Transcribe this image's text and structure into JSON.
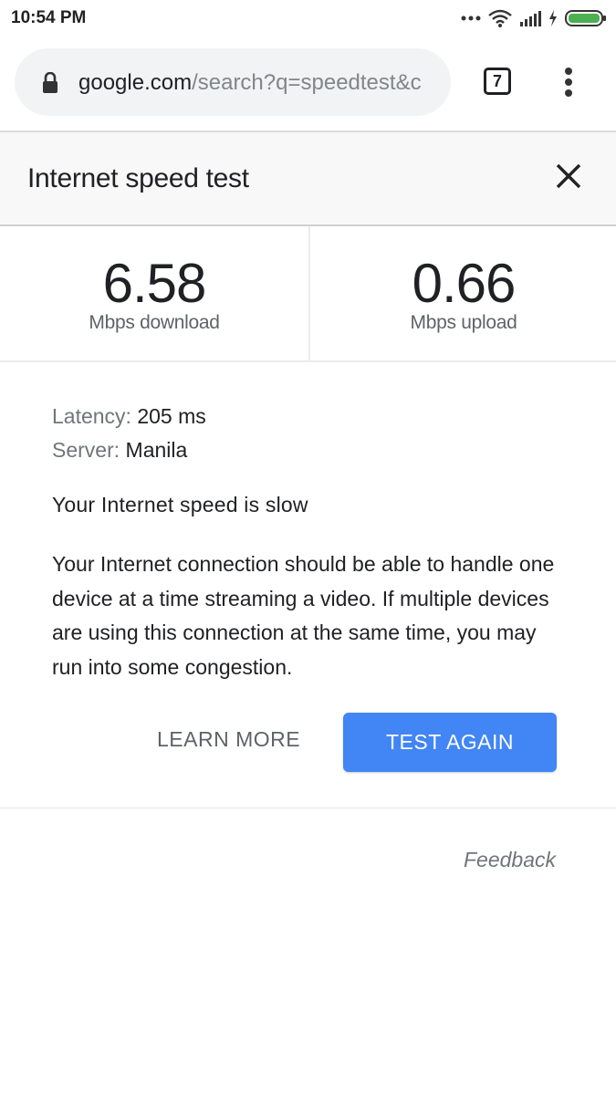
{
  "status_bar": {
    "time": "10:54 PM"
  },
  "browser": {
    "url_host": "google.com",
    "url_rest": "/search?q=speedtest&c",
    "tab_count": "7"
  },
  "speed_test": {
    "title": "Internet speed test",
    "download": {
      "value": "6.58",
      "label": "Mbps download"
    },
    "upload": {
      "value": "0.66",
      "label": "Mbps upload"
    },
    "latency_label": "Latency:",
    "latency_value": "205 ms",
    "server_label": "Server:",
    "server_value": "Manila",
    "verdict": "Your Internet speed is slow",
    "explanation": "Your Internet connection should be able to handle one device at a time streaming a video. If multiple devices are using this connection at the same time, you may run into some congestion.",
    "learn_more_label": "LEARN MORE",
    "test_again_label": "TEST AGAIN",
    "feedback_label": "Feedback"
  },
  "colors": {
    "accent": "#4285f4",
    "battery": "#4caf50"
  }
}
